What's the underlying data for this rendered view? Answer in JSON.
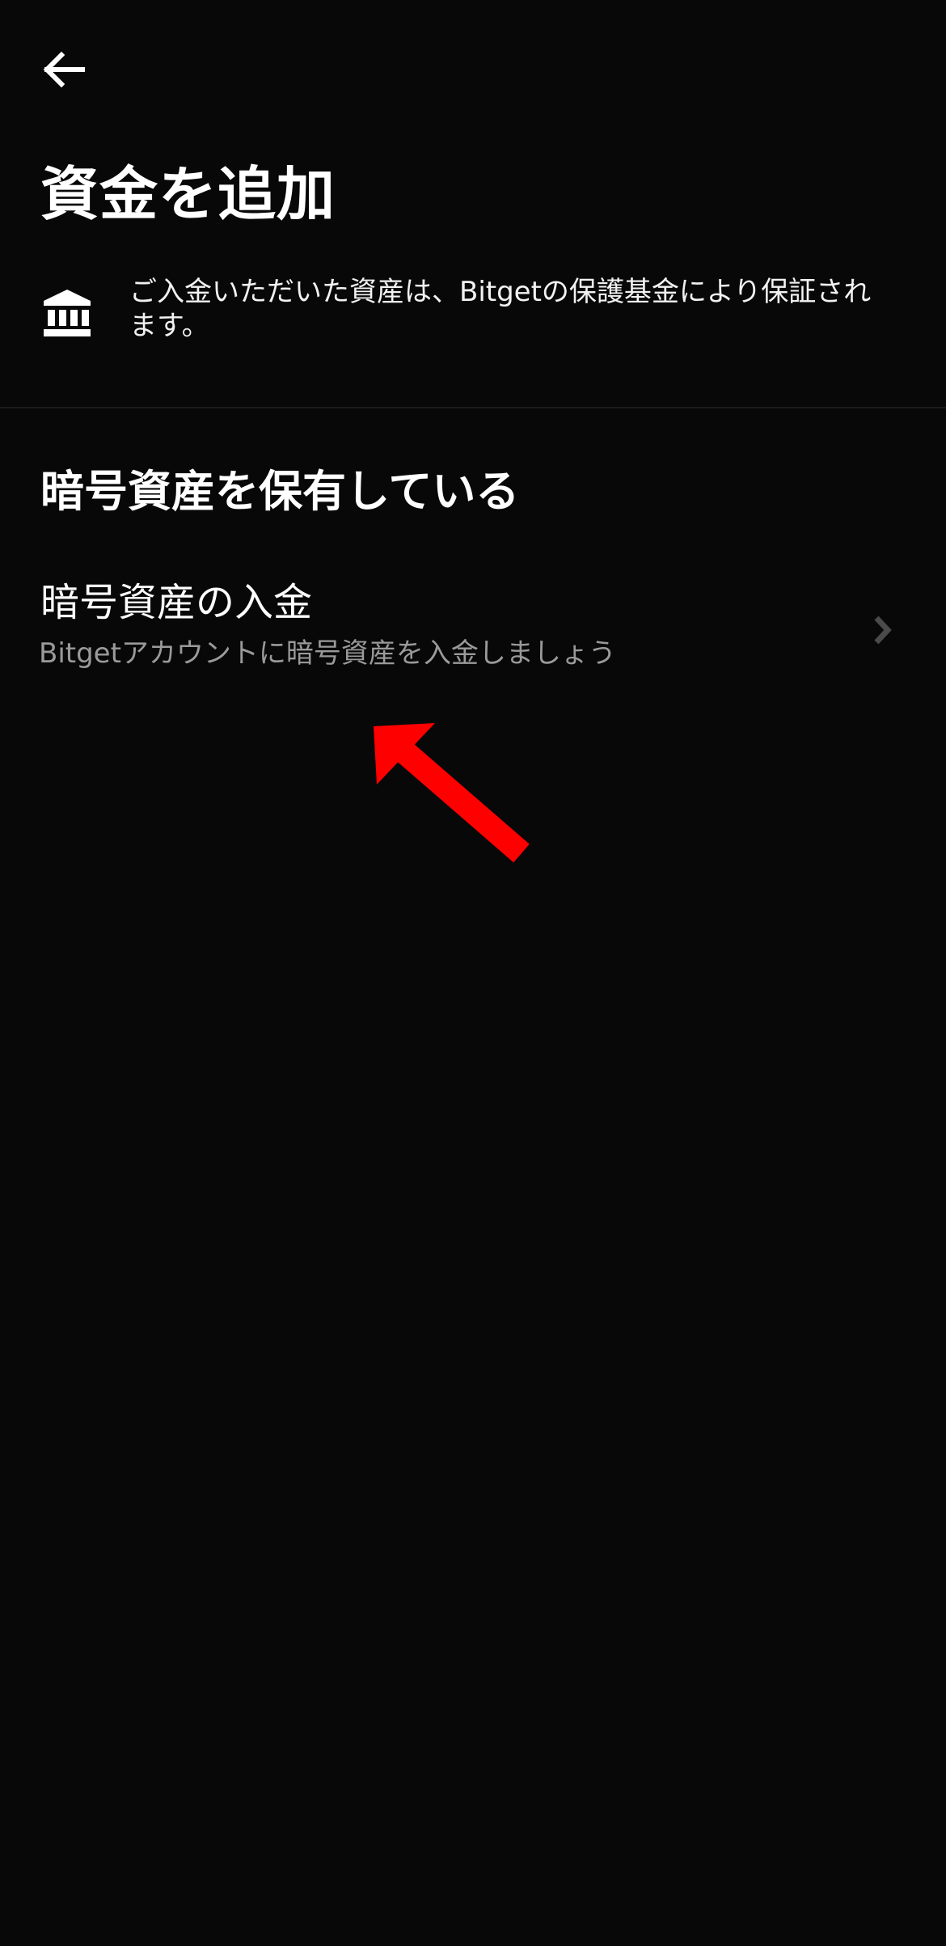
{
  "header": {
    "back_icon": "arrow-left-icon",
    "title": "資金を追加"
  },
  "notice": {
    "icon": "bank-icon",
    "text": "ご入金いただいた資産は、Bitgetの保護基金により保証されます。"
  },
  "section": {
    "title": "暗号資産を保有している",
    "items": [
      {
        "title": "暗号資産の入金",
        "subtitle": "Bitgetアカウントに暗号資産を入金しましょう",
        "icon": "chevron-right-icon"
      }
    ]
  },
  "colors": {
    "background": "#080808",
    "text_primary": "#ffffff",
    "text_secondary": "#9a9a9a",
    "annotation": "#ff0000"
  }
}
